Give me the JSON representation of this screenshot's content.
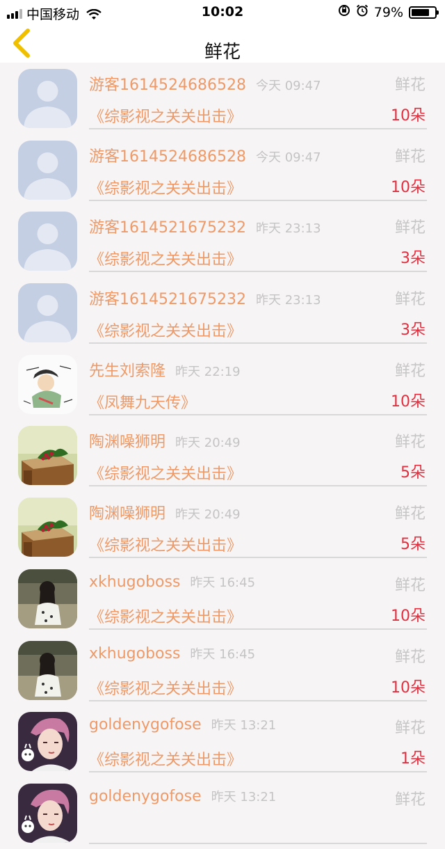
{
  "status": {
    "carrier": "中国移动",
    "time": "10:02",
    "battery_text": "79%",
    "battery_level": 0.79
  },
  "nav": {
    "title": "鲜花",
    "back_icon": "chevron-left-icon"
  },
  "colors": {
    "accent": "#f0c000",
    "name": "#ee9a68",
    "count": "#e0303f",
    "meta": "#c4c4c4"
  },
  "items": [
    {
      "name": "游客1614524686528",
      "time": "今天 09:47",
      "gift": "鲜花",
      "book": "《综影视之关关出击》",
      "count": "10朵",
      "avatar": "default"
    },
    {
      "name": "游客1614524686528",
      "time": "今天 09:47",
      "gift": "鲜花",
      "book": "《综影视之关关出击》",
      "count": "10朵",
      "avatar": "default"
    },
    {
      "name": "游客1614521675232",
      "time": "昨天 23:13",
      "gift": "鲜花",
      "book": "《综影视之关关出击》",
      "count": "3朵",
      "avatar": "default"
    },
    {
      "name": "游客1614521675232",
      "time": "昨天 23:13",
      "gift": "鲜花",
      "book": "《综影视之关关出击》",
      "count": "3朵",
      "avatar": "default"
    },
    {
      "name": "先生刘索隆",
      "time": "昨天 22:19",
      "gift": "鲜花",
      "book": "《凤舞九天传》",
      "count": "10朵",
      "avatar": "cartoon"
    },
    {
      "name": "陶渊噪狮明",
      "time": "昨天 20:49",
      "gift": "鲜花",
      "book": "《综影视之关关出击》",
      "count": "5朵",
      "avatar": "books"
    },
    {
      "name": "陶渊噪狮明",
      "time": "昨天 20:49",
      "gift": "鲜花",
      "book": "《综影视之关关出击》",
      "count": "5朵",
      "avatar": "books"
    },
    {
      "name": "xkhugoboss",
      "time": "昨天 16:45",
      "gift": "鲜花",
      "book": "《综影视之关关出击》",
      "count": "10朵",
      "avatar": "girl"
    },
    {
      "name": "xkhugoboss",
      "time": "昨天 16:45",
      "gift": "鲜花",
      "book": "《综影视之关关出击》",
      "count": "10朵",
      "avatar": "girl"
    },
    {
      "name": "goldenygofose",
      "time": "昨天 13:21",
      "gift": "鲜花",
      "book": "《综影视之关关出击》",
      "count": "1朵",
      "avatar": "idol"
    },
    {
      "name": "goldenygofose",
      "time": "昨天 13:21",
      "gift": "鲜花",
      "book": "",
      "count": "",
      "avatar": "idol"
    }
  ]
}
